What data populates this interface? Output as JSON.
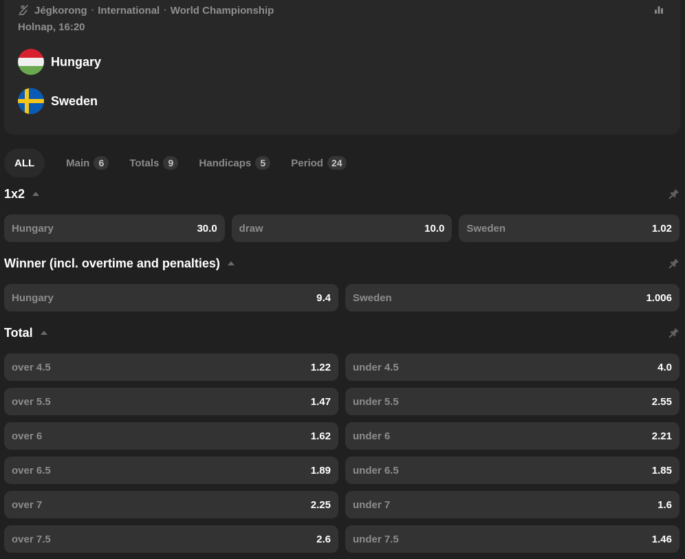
{
  "match": {
    "breadcrumb": {
      "sport_icon": "hockey-stick-icon",
      "sport": "Jégkorong",
      "category": "International",
      "tournament": "World Championship",
      "separator": "•"
    },
    "time": "Holnap, 16:20",
    "stats_icon": "bar-chart-icon",
    "home": {
      "name": "Hungary",
      "flag_colors": [
        "#d8202f",
        "#f0f0f0",
        "#6aa84f"
      ]
    },
    "away": {
      "name": "Sweden",
      "flag_colors": [
        "#0a5bb5",
        "#f5c518"
      ]
    }
  },
  "tabs": [
    {
      "label": "ALL",
      "count": null,
      "active": true
    },
    {
      "label": "Main",
      "count": "6",
      "active": false
    },
    {
      "label": "Totals",
      "count": "9",
      "active": false
    },
    {
      "label": "Handicaps",
      "count": "5",
      "active": false
    },
    {
      "label": "Period",
      "count": "24",
      "active": false
    }
  ],
  "markets": {
    "m1x2": {
      "title": "1x2",
      "odds": [
        {
          "label": "Hungary",
          "value": "30.0"
        },
        {
          "label": "draw",
          "value": "10.0"
        },
        {
          "label": "Sweden",
          "value": "1.02"
        }
      ]
    },
    "winner": {
      "title": "Winner (incl. overtime and penalties)",
      "odds": [
        {
          "label": "Hungary",
          "value": "9.4"
        },
        {
          "label": "Sweden",
          "value": "1.006"
        }
      ]
    },
    "total": {
      "title": "Total",
      "rows": [
        [
          {
            "label": "over 4.5",
            "value": "1.22"
          },
          {
            "label": "under 4.5",
            "value": "4.0"
          }
        ],
        [
          {
            "label": "over 5.5",
            "value": "1.47"
          },
          {
            "label": "under 5.5",
            "value": "2.55"
          }
        ],
        [
          {
            "label": "over 6",
            "value": "1.62"
          },
          {
            "label": "under 6",
            "value": "2.21"
          }
        ],
        [
          {
            "label": "over 6.5",
            "value": "1.89"
          },
          {
            "label": "under 6.5",
            "value": "1.85"
          }
        ],
        [
          {
            "label": "over 7",
            "value": "2.25"
          },
          {
            "label": "under 7",
            "value": "1.6"
          }
        ],
        [
          {
            "label": "over 7.5",
            "value": "2.6"
          },
          {
            "label": "under 7.5",
            "value": "1.46"
          }
        ]
      ]
    }
  },
  "colors": {
    "background": "#202020",
    "card": "#282828",
    "odd_button": "#333333",
    "muted_text": "#8c8c8c",
    "value_text": "#ffffff"
  }
}
